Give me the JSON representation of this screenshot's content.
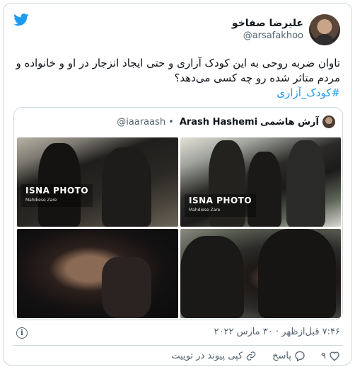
{
  "author": {
    "name": "علیرضا صفاخو",
    "handle": "@arsafakhoo"
  },
  "tweet": {
    "text": "تاوان ضربه روحی به این کودک آزاری و حتی ایجاد انزجار در او و خانواده و مردم متاثر شده رو چه کسی می‌دهد؟",
    "hashtag": "#کودک_آزاری"
  },
  "quoted": {
    "name": "آرش هاشمی",
    "english_name": "Arash Hashemi",
    "handle": "@iaaraash",
    "separator": "•"
  },
  "photos": {
    "watermark": "ISNA PHOTO",
    "photographer": "Mahdiese Zare"
  },
  "meta": {
    "timestamp": "۷:۴۶ قبل‌ازظهر · ۳۰ مارس ۲۰۲۲",
    "info_icon_glyph": "i"
  },
  "actions": {
    "like_count": "۹",
    "reply_label": "پاسخ",
    "copy_link_label": "کپی پیوند در توییت"
  },
  "colors": {
    "brand_blue": "#1d9bf0",
    "text_secondary": "#536471",
    "border": "#cfd9de"
  },
  "icons": [
    "twitter-bird-icon",
    "heart-icon",
    "reply-icon",
    "link-icon",
    "info-icon"
  ]
}
